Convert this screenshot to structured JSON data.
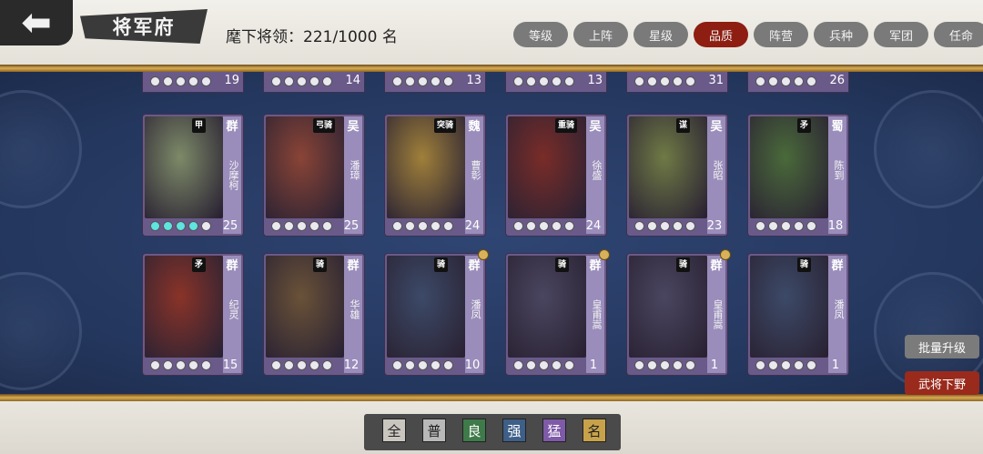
{
  "header": {
    "title": "将军府",
    "count_label": "麾下将领：221/1000 名",
    "sort_tabs": [
      "等级",
      "上阵",
      "星级",
      "品质",
      "阵营",
      "兵种",
      "军团",
      "任命"
    ],
    "active_tab": "品质"
  },
  "peek_row": [
    {
      "level": "19",
      "stars": 0
    },
    {
      "level": "14",
      "stars": 0
    },
    {
      "level": "13",
      "stars": 0
    },
    {
      "level": "13",
      "stars": 0
    },
    {
      "level": "31",
      "stars": 0
    },
    {
      "level": "26",
      "stars": 0
    }
  ],
  "cards": [
    {
      "name": "沙摩柯",
      "faction": "群",
      "troop": "甲",
      "level": "25",
      "stars": 4,
      "badge": false,
      "color": "#7d8a68"
    },
    {
      "name": "潘璋",
      "faction": "吴",
      "troop": "弓骑",
      "level": "25",
      "stars": 0,
      "badge": false,
      "color": "#8a4436"
    },
    {
      "name": "曹彰",
      "faction": "魏",
      "troop": "突骑",
      "level": "24",
      "stars": 0,
      "badge": false,
      "color": "#a0803a"
    },
    {
      "name": "徐盛",
      "faction": "吴",
      "troop": "重骑",
      "level": "24",
      "stars": 0,
      "badge": false,
      "color": "#7a2c28"
    },
    {
      "name": "张昭",
      "faction": "吴",
      "troop": "谋",
      "level": "23",
      "stars": 0,
      "badge": false,
      "color": "#6f7a45"
    },
    {
      "name": "陈到",
      "faction": "蜀",
      "troop": "矛",
      "level": "18",
      "stars": 0,
      "badge": false,
      "color": "#4a6a3a"
    },
    {
      "name": "纪灵",
      "faction": "群",
      "troop": "矛",
      "level": "15",
      "stars": 0,
      "badge": false,
      "color": "#8a3328"
    },
    {
      "name": "华雄",
      "faction": "群",
      "troop": "骑",
      "level": "12",
      "stars": 0,
      "badge": false,
      "color": "#6a5238"
    },
    {
      "name": "潘凤",
      "faction": "群",
      "troop": "骑",
      "level": "10",
      "stars": 0,
      "badge": true,
      "color": "#3c4a68"
    },
    {
      "name": "皇甫嵩",
      "faction": "群",
      "troop": "骑",
      "level": "1",
      "stars": 0,
      "badge": true,
      "color": "#4a4660"
    },
    {
      "name": "皇甫嵩",
      "faction": "群",
      "troop": "骑",
      "level": "1",
      "stars": 0,
      "badge": true,
      "color": "#4a4660"
    },
    {
      "name": "潘凤",
      "faction": "群",
      "troop": "骑",
      "level": "1",
      "stars": 0,
      "badge": false,
      "color": "#3c4a68"
    }
  ],
  "actions": {
    "batch_upgrade": "批量升级",
    "dismiss": "武将下野"
  },
  "quality_filters": [
    {
      "label": "全",
      "bg": "#c9c6c0",
      "fg": "#222"
    },
    {
      "label": "普",
      "bg": "#b8b8b8",
      "fg": "#222"
    },
    {
      "label": "良",
      "bg": "#3f7a4a",
      "fg": "#fff"
    },
    {
      "label": "强",
      "bg": "#3d5f88",
      "fg": "#fff"
    },
    {
      "label": "猛",
      "bg": "#7e5aa8",
      "fg": "#fff"
    },
    {
      "label": "名",
      "bg": "#c8a24a",
      "fg": "#222"
    }
  ]
}
